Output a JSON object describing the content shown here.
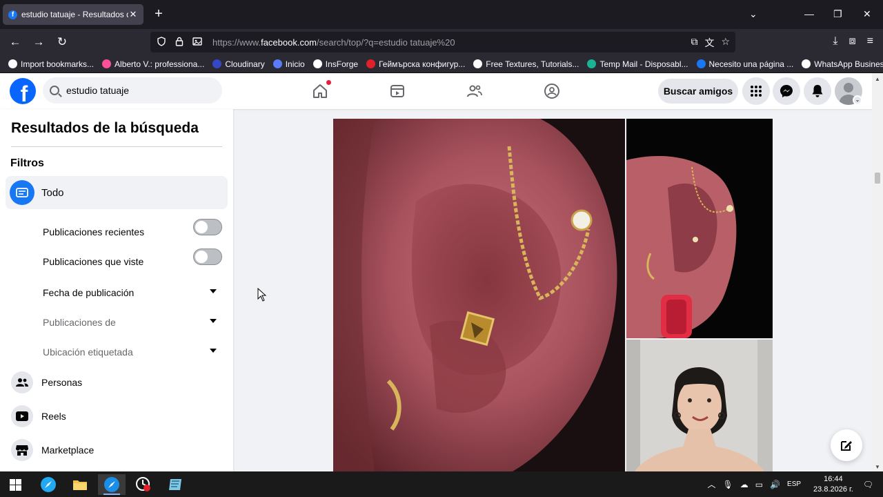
{
  "browser": {
    "tab_title": "estudio tatuaje - Resultados de",
    "tab_close": "✕",
    "new_tab": "+",
    "url_prefix": "https://www.",
    "url_domain": "facebook.com",
    "url_path": "/search/top/?q=estudio tatuaje%20",
    "bookmarks": [
      {
        "label": "Import bookmarks...",
        "color": "#fbfbfe"
      },
      {
        "label": "Alberto V.: professiona...",
        "color": "#ff4f9a"
      },
      {
        "label": "Cloudinary",
        "color": "#3448c5"
      },
      {
        "label": "Inicio",
        "color": "#5b7cfa"
      },
      {
        "label": "InsForge",
        "color": "#ffffff"
      },
      {
        "label": "Геймърска конфигур...",
        "color": "#e0202a"
      },
      {
        "label": "Free Textures, Tutorials...",
        "color": "#fbfbfe"
      },
      {
        "label": "Temp Mail - Disposabl...",
        "color": "#1ab394"
      },
      {
        "label": "Necesito una página ...",
        "color": "#1877f2"
      },
      {
        "label": "WhatsApp Business",
        "color": "#ffffff"
      }
    ]
  },
  "fb": {
    "search_value": "estudio tatuaje",
    "find_friends": "Buscar amigos",
    "accent": "#1877f2"
  },
  "sidebar": {
    "title": "Resultados de la búsqueda",
    "filters_label": "Filtros",
    "all_label": "Todo",
    "sub_filters": [
      {
        "label": "Publicaciones recientes",
        "control": "toggle",
        "on": false
      },
      {
        "label": "Publicaciones que viste",
        "control": "toggle",
        "on": false
      },
      {
        "label": "Fecha de publicación",
        "control": "dropdown"
      },
      {
        "label": "Publicaciones de",
        "control": "dropdown"
      },
      {
        "label": "Ubicación etiquetada",
        "control": "dropdown"
      }
    ],
    "categories": [
      {
        "label": "Personas",
        "icon": "people-icon"
      },
      {
        "label": "Reels",
        "icon": "reels-icon"
      },
      {
        "label": "Marketplace",
        "icon": "marketplace-icon"
      }
    ]
  },
  "taskbar": {
    "lang": "ESP",
    "time": "16:44",
    "date": "23.8.2026 г."
  }
}
